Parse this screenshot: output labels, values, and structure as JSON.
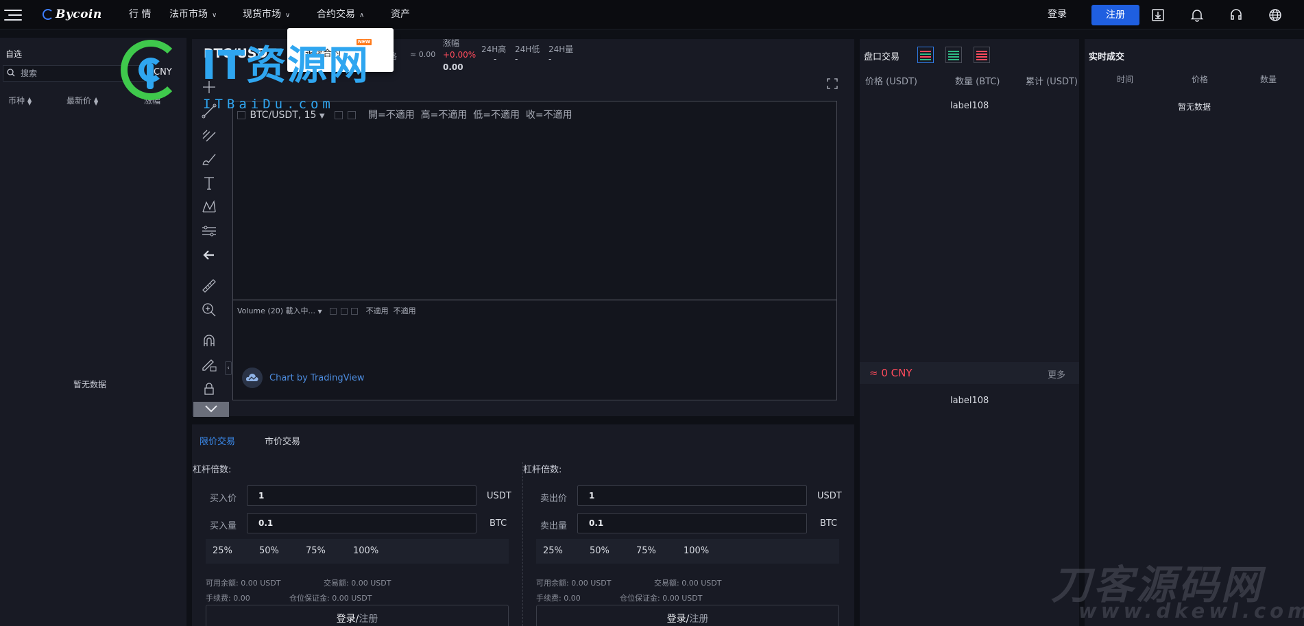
{
  "nav": {
    "logo_text": "Bycoin",
    "items": [
      {
        "label": "行 情"
      },
      {
        "label": "法币市场"
      },
      {
        "label": "现货市场"
      },
      {
        "label": "合约交易"
      },
      {
        "label": "资产"
      }
    ],
    "login_label": "登录",
    "register_label": "注册",
    "accent_color": "#1f5fe0",
    "icons": [
      "download-icon",
      "bell-icon",
      "headset-icon",
      "globe-icon"
    ]
  },
  "dropdown": {
    "item_label": "永续合约",
    "badge": "NEW"
  },
  "watchlist": {
    "title": "自选",
    "search_placeholder": "搜索",
    "currency": "CNY",
    "col_coin": "币种",
    "col_last": "最新价",
    "col_change": "涨幅",
    "empty": "暂无数据"
  },
  "ticker": {
    "pair": "BTC/USDT",
    "price_label": "格",
    "price_approx": "≈ 0.00",
    "change_label": "涨幅",
    "change_value": "+0.00%",
    "change_sub": "0.00",
    "high_label": "24H高",
    "high_value": "-",
    "low_label": "24H低",
    "low_value": "-",
    "vol_label": "24H量",
    "vol_value": "-",
    "negative_color": "#ff4b5c"
  },
  "chart": {
    "symbol": "BTC/USDT, 15",
    "open": "開=不適用",
    "high": "高=不適用",
    "low": "低=不適用",
    "close": "收=不適用",
    "volume_legend": "Volume (20) 載入中...",
    "vol_na1": "不適用",
    "vol_na2": "不適用",
    "credit": "Chart by TradingView",
    "tools": [
      "crosshair-icon",
      "trendline-icon",
      "fib-icon",
      "brush-icon",
      "text-icon",
      "pattern-icon",
      "measure-icon",
      "arrow-left-icon",
      "ruler-icon",
      "zoom-in-icon",
      "magnet-icon",
      "lock-pencil-icon",
      "lock-icon"
    ]
  },
  "order": {
    "tab_limit": "限价交易",
    "tab_market": "市价交易",
    "buy": {
      "leverage_label": "杠杆倍数:",
      "price_label": "买入价",
      "price_value": "1",
      "price_unit": "USDT",
      "qty_label": "买入量",
      "qty_value": "0.1",
      "qty_unit": "BTC",
      "pcts": [
        "25%",
        "50%",
        "75%",
        "100%"
      ],
      "avail": "可用余额:  0.00 USDT",
      "volume": "交易额:  0.00 USDT",
      "fee": "手续费:  0.00",
      "margin": "仓位保证金:  0.00 USDT",
      "submit_a": "登录/",
      "submit_b": "注册"
    },
    "sell": {
      "leverage_label": "杠杆倍数:",
      "price_label": "卖出价",
      "price_value": "1",
      "price_unit": "USDT",
      "qty_label": "卖出量",
      "qty_value": "0.1",
      "qty_unit": "BTC",
      "pcts": [
        "25%",
        "50%",
        "75%",
        "100%"
      ],
      "avail": "可用余额:  0.00 USDT",
      "volume": "交易额:  0.00 USDT",
      "fee": "手续费:  0.00",
      "margin": "仓位保证金:  0.00 USDT",
      "submit_a": "登录/",
      "submit_b": "注册"
    }
  },
  "book": {
    "title": "盘口交易",
    "col_price": "价格 (USDT)",
    "col_qty": "数量 (BTC)",
    "col_total": "累计 (USDT)",
    "label_top": "label108",
    "mid_price": "≈ 0 CNY",
    "more": "更多",
    "label_bottom": "label108"
  },
  "trades": {
    "title": "实时成交",
    "col_time": "时间",
    "col_price": "价格",
    "col_qty": "数量",
    "empty": "暂无数据"
  },
  "watermarks": {
    "left_big": "IT资源网",
    "left_small": "ITBaiDu.com",
    "right_big": "刀客源码网",
    "right_small": "www.dkewl.com"
  }
}
